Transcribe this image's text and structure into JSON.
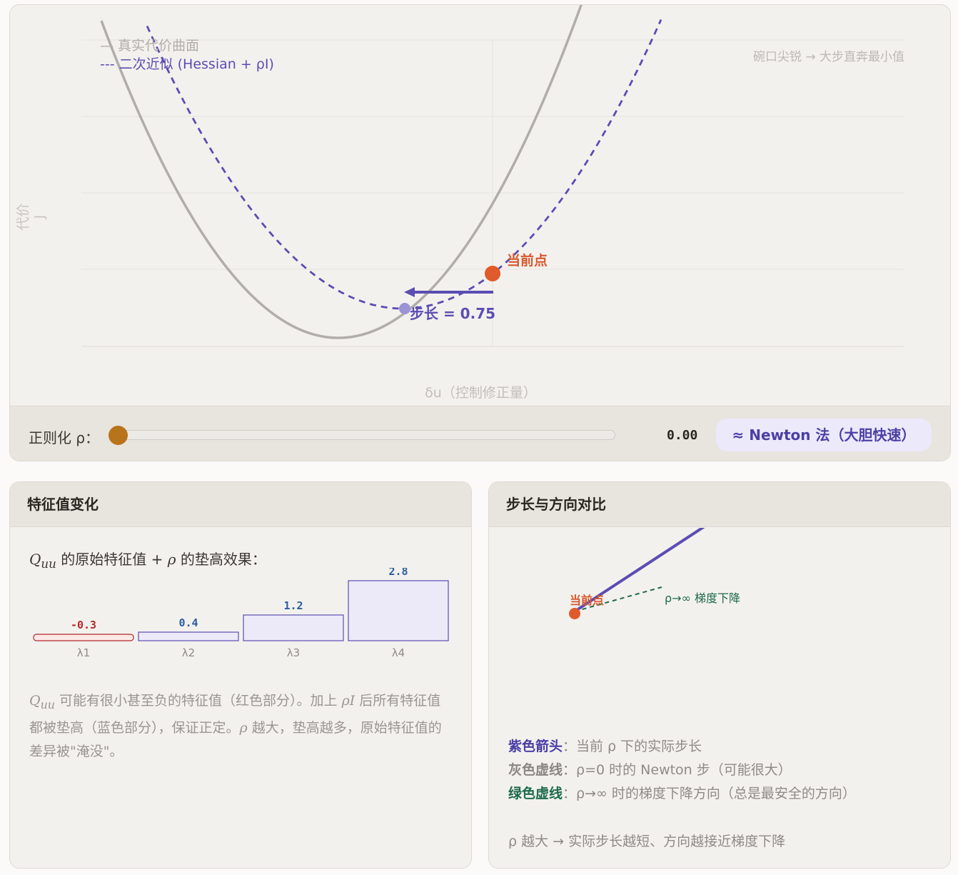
{
  "plot": {
    "legend_true": "— 真实代价曲面",
    "legend_quad": "--- 二次近似 (Hessian + ρI)",
    "hint": "碗口尖锐 → 大步直奔最小值",
    "y_label": "代价 J",
    "x_label": "δu（控制修正量）",
    "current_point_label": "当前点",
    "step_label": "步长 = 0.75",
    "colors": {
      "true_curve": "#b0adaa",
      "quad_curve": "#5b4db3",
      "current_point": "#e05a2b"
    }
  },
  "control": {
    "label": "正则化 ρ：",
    "value": "0.00",
    "rho": 0.0,
    "mode": "≈ Newton 法（大胆快速）"
  },
  "eigen_panel": {
    "title": "特征值变化",
    "intro_sym": "Q",
    "intro_sub": "uu",
    "intro_text": " 的原始特征值 + ",
    "intro_rho": "ρ",
    "intro_tail": " 的垫高效果：",
    "desc_sym": "Q",
    "desc_sub": "uu",
    "desc_a": " 可能有很小甚至负的特征值（红色部分）。加上 ",
    "desc_rho": "ρI",
    "desc_b": " 后所有特征值都被垫高（蓝色部分），保证正定。",
    "desc_rho2": "ρ",
    "desc_c": " 越大，垫高越多，原始特征值的差异被\"淹没\"。"
  },
  "chart_data": {
    "type": "bar",
    "categories": [
      "λ1",
      "λ2",
      "λ3",
      "λ4"
    ],
    "values": [
      -0.3,
      0.4,
      1.2,
      2.8
    ],
    "data_labels": [
      "-0.3",
      "0.4",
      "1.2",
      "2.8"
    ],
    "colors": {
      "negative": "#b22b2b",
      "positive": "#5b4db3",
      "label": "#2a5da0"
    }
  },
  "direction_panel": {
    "title": "步长与方向对比",
    "point_label": "当前点",
    "gradient_label": "ρ→∞ 梯度下降",
    "note_purple_key": "紫色箭头",
    "note_purple_val": "：当前 ρ 下的实际步长",
    "note_gray_key": "灰色虚线",
    "note_gray_val": "：ρ=0 时的 Newton 步（可能很大）",
    "note_green_key": "绿色虚线",
    "note_green_val": "：ρ→∞ 时的梯度下降方向（总是最安全的方向）",
    "footer": "ρ 越大 → 实际步长越短、方向越接近梯度下降"
  }
}
